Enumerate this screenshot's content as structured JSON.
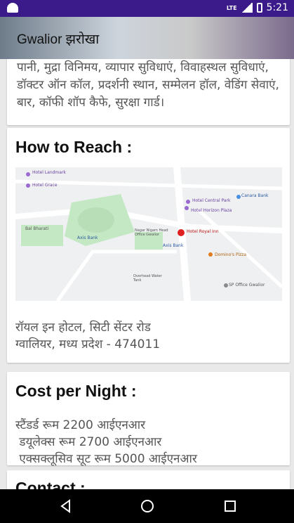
{
  "status_bar": {
    "network": "LTE",
    "time": "5:21"
  },
  "header": {
    "title": "Gwalior झरोखा"
  },
  "amenities_text": "पानी, मुद्रा विनिमय, व्यापार सुविधाएं, विवाहस्थल सुविधाएं, डॉक्टर ऑन कॉल, प्रदर्शनी स्थान, सम्मेलन हॉल, वेडिंग सेवाएं, बार, कॉफी शॉप  कैफे, सुरक्षा गार्ड।",
  "how_to_reach": {
    "heading": "How to Reach :",
    "address": "रॉयल इन होटल, सिटी सेंटर रोड\nग्वालियर, मध्य प्रदेश - 474011",
    "map_labels": {
      "hotel_landmark": "Hotel Landmark",
      "hotel_grace": "Hotel Grace",
      "bal_bharati": "Bal Bharati",
      "axis_bank": "Axis Bank",
      "hotel_central_park": "Hotel Central Park",
      "hotel_horizon_plaza": "Hotel Horizon Plaza",
      "canara_bank": "Canara Bank",
      "hotel_royal_inn": "Hotel Royal Inn",
      "dominos": "Domino's Pizza",
      "sp_office": "SP Office Gwalior",
      "overhead_tank": "Overhead Water Tank",
      "nagar_nigam": "Nagar Nigam Head Office Gwalior",
      "axis_bank_2": "Axis Bank"
    }
  },
  "cost": {
    "heading": "Cost per Night :",
    "lines": "स्टैंडर्ड रूम 2200 आईएनआर\n डयूलेक्स रूम 2700 आईएनआर\n एक्सक्लूसिव सूट रूम 5000 आईएनआर"
  },
  "contact": {
    "heading": "Contact :"
  },
  "colors": {
    "status_bar": "#3b1a8a",
    "map_green": "#c4e8c4",
    "map_pin": "#e02020"
  }
}
